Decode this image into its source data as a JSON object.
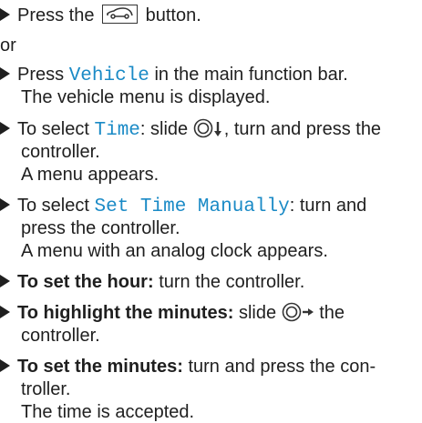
{
  "steps": {
    "s1": {
      "pre": "Press the",
      "post": "button.",
      "icon": "car-icon"
    },
    "or": "or",
    "s2": {
      "pre": "Press",
      "key": "Vehicle",
      "post": "in the main function bar.",
      "result": "The vehicle menu is displayed."
    },
    "s3": {
      "pre": "To select",
      "key": "Time",
      "mid": ": slide",
      "post": ", turn and press the",
      "cont": "controller.",
      "result": "A menu appears.",
      "icon": "controller-down-icon"
    },
    "s4": {
      "pre": "To select",
      "key": "Set Time Manually",
      "post": ": turn and",
      "cont": "press the controller.",
      "result": "A menu with an analog clock appears."
    },
    "s5": {
      "bold": "To set the hour:",
      "post": "turn the controller."
    },
    "s6": {
      "bold": "To highlight the minutes:",
      "mid": "slide",
      "post": "the",
      "cont": "controller.",
      "icon": "controller-right-icon"
    },
    "s7": {
      "bold": "To set the minutes:",
      "post": "turn and press the con-",
      "cont": "troller.",
      "result": "The time is accepted."
    }
  }
}
